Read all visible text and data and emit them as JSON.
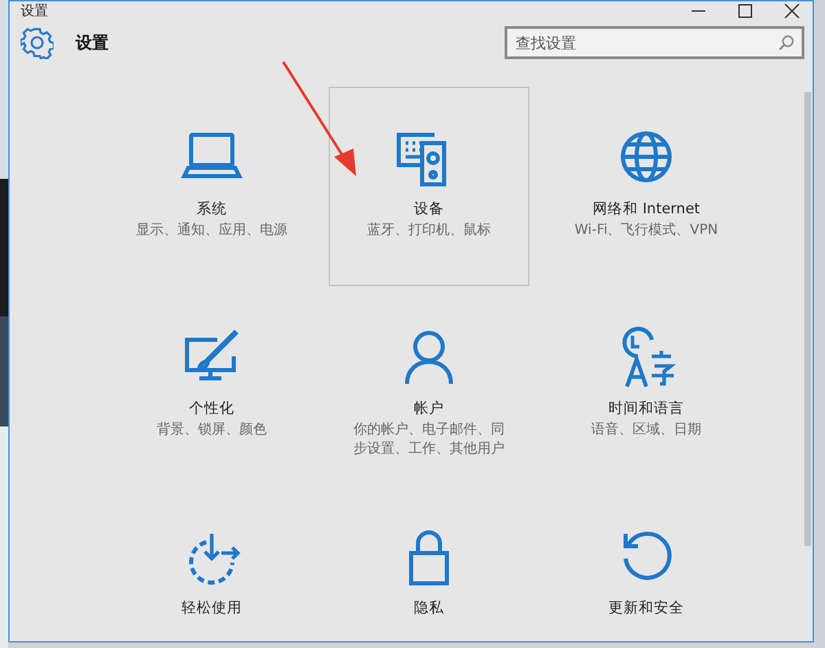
{
  "window": {
    "title": "设置"
  },
  "header": {
    "title": "设置"
  },
  "search": {
    "placeholder": "查找设置"
  },
  "tiles": [
    {
      "name": "系统",
      "description": "显示、通知、应用、电源",
      "selected": false
    },
    {
      "name": "设备",
      "description": "蓝牙、打印机、鼠标",
      "selected": true
    },
    {
      "name": "网络和 Internet",
      "description": "Wi-Fi、飞行模式、VPN",
      "selected": false
    },
    {
      "name": "个性化",
      "description": "背景、锁屏、颜色",
      "selected": false
    },
    {
      "name": "帐户",
      "description": "你的帐户、电子邮件、同步设置、工作、其他用户",
      "selected": false
    },
    {
      "name": "时间和语言",
      "description": "语音、区域、日期",
      "selected": false
    },
    {
      "name": "轻松使用",
      "selected": false
    },
    {
      "name": "隐私",
      "selected": false
    },
    {
      "name": "更新和安全",
      "selected": false
    }
  ]
}
